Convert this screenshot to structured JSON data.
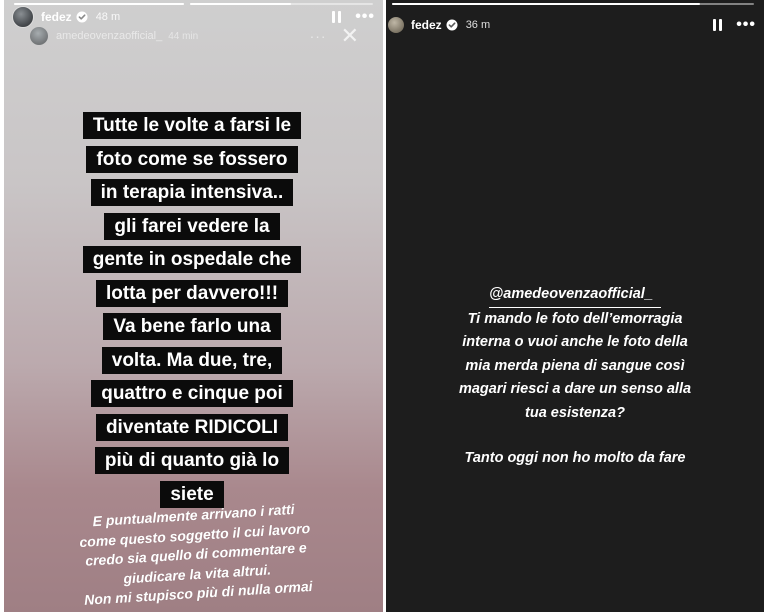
{
  "left_story": {
    "progress": [
      1,
      0.55
    ],
    "user": "fedez",
    "time": "48 m",
    "repost": {
      "user": "amedeovenzaofficial_",
      "time": "44 min",
      "more": "···",
      "close": "✕"
    },
    "quote_lines": [
      "Tutte le volte a farsi le",
      "foto come se fossero",
      "in terapia intensiva..",
      "gli farei vedere la",
      "gente in ospedale che",
      "lotta per davvero!!!",
      "Va bene farlo una",
      "volta. Ma due, tre,",
      "quattro e cinque poi",
      "diventate RIDICOLI",
      "più di quanto già lo",
      "siete"
    ],
    "note_lines": [
      "E puntualmente arrivano i ratti",
      "come questo soggetto il cui lavoro",
      "credo sia quello di commentare e",
      "giudicare la vita altrui.",
      "Non mi stupisco più di nulla ormai"
    ]
  },
  "right_story": {
    "progress": [
      1,
      0.85
    ],
    "user": "fedez",
    "time": "36 m",
    "mention": "@amedeovenzaofficial_",
    "reply_lines": [
      "Ti mando le foto dell’emorragia",
      "interna o vuoi anche le foto della",
      "mia merda piena di sangue così",
      "magari riesci a dare un senso alla",
      "tua esistenza?"
    ],
    "closing": "Tanto oggi non ho molto da fare"
  },
  "icons": {
    "more": "more-dots-icon",
    "pause": "pause-icon",
    "verified": "verified-badge-icon"
  },
  "colors": {
    "verified_blue": "#3897f0",
    "quote_bg": "#0b0b0b",
    "right_bg": "#1d1d1d"
  }
}
